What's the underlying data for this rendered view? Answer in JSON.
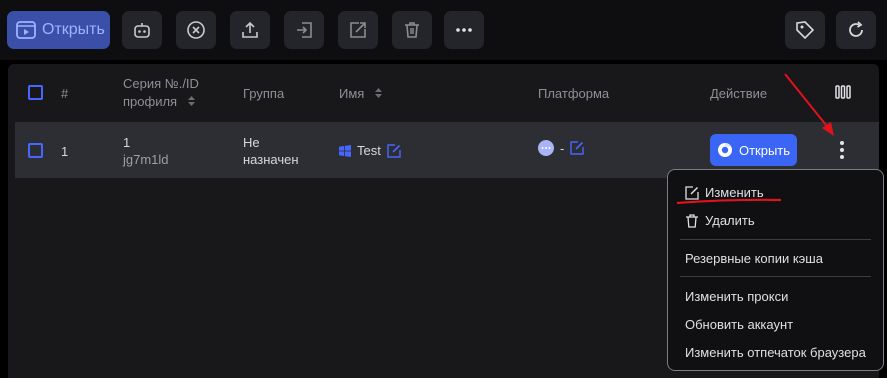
{
  "toolbar": {
    "open_label": "Открыть",
    "buttons": [
      "robot-icon",
      "close-circle-icon",
      "upload-icon",
      "import-icon",
      "share-icon",
      "trash-icon",
      "more-icon"
    ],
    "right_buttons": [
      "tag-icon",
      "refresh-icon"
    ]
  },
  "table": {
    "headers": {
      "num": "#",
      "serial_line1": "Серия №./ID",
      "serial_line2": "профиля",
      "group": "Группа",
      "name": "Имя",
      "platform": "Платформа",
      "action": "Действие"
    },
    "rows": [
      {
        "index": "1",
        "serial": "1",
        "id": "jg7m1ld",
        "group_line1": "Не",
        "group_line2": "назначен",
        "name": "Test",
        "platform": "-",
        "action_label": "Открыть"
      }
    ]
  },
  "menu": {
    "edit": "Изменить",
    "delete": "Удалить",
    "backup": "Резервные копии кэша",
    "change_proxy": "Изменить прокси",
    "refresh_account": "Обновить аккаунт",
    "change_fingerprint": "Изменить отпечаток браузера"
  },
  "colors": {
    "accent": "#3b66f5",
    "annotation": "#e0121b"
  }
}
